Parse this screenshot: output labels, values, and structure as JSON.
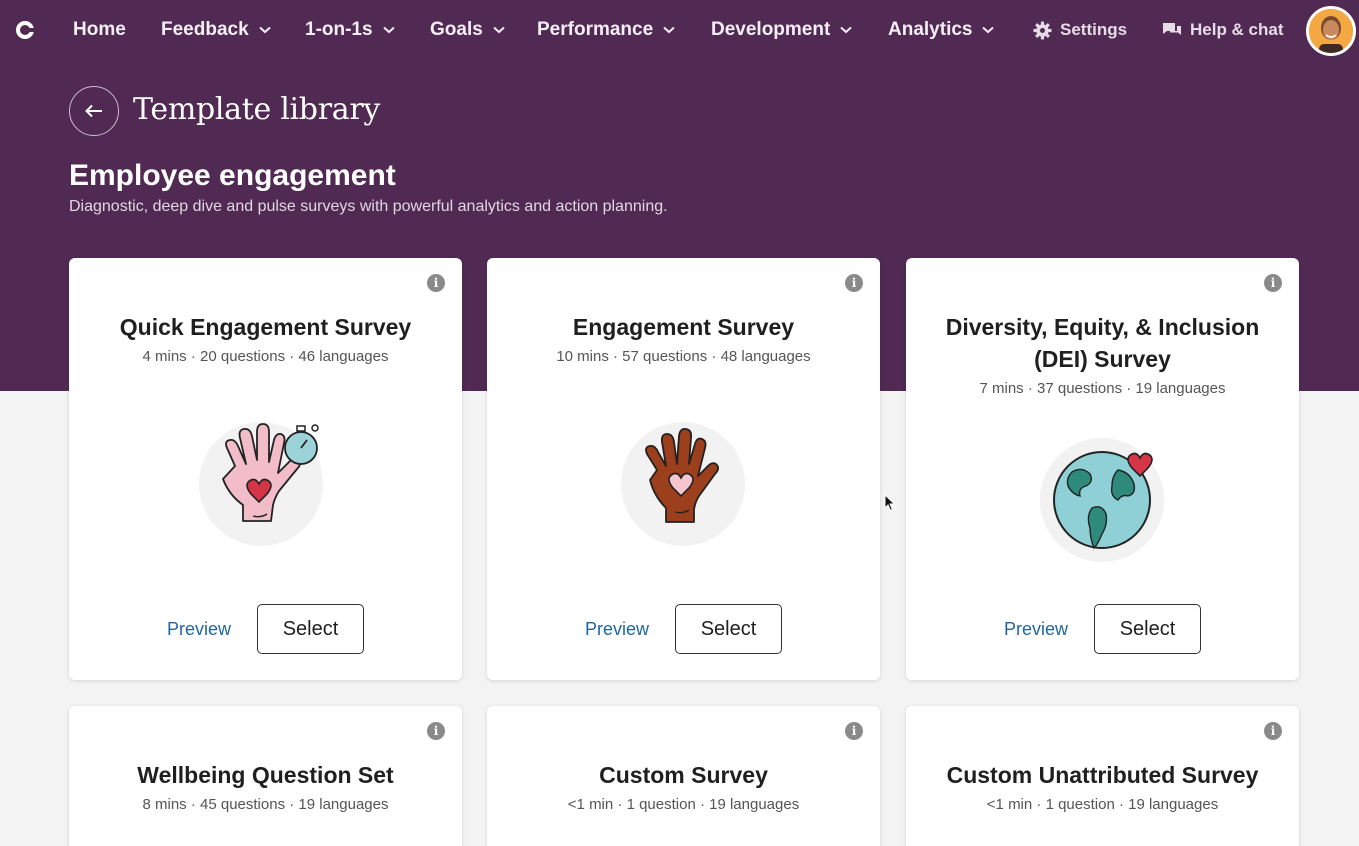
{
  "nav": {
    "items": [
      {
        "label": "Home",
        "has_dropdown": false
      },
      {
        "label": "Feedback",
        "has_dropdown": true
      },
      {
        "label": "1-on-1s",
        "has_dropdown": true
      },
      {
        "label": "Goals",
        "has_dropdown": true
      },
      {
        "label": "Performance",
        "has_dropdown": true
      },
      {
        "label": "Development",
        "has_dropdown": true
      },
      {
        "label": "Analytics",
        "has_dropdown": true
      }
    ],
    "settings_label": "Settings",
    "help_label": "Help & chat"
  },
  "header": {
    "title": "Template library"
  },
  "section": {
    "title": "Employee engagement",
    "description": "Diagnostic, deep dive and pulse surveys with powerful analytics and action planning."
  },
  "cards": [
    {
      "title": "Quick Engagement Survey",
      "meta": "4 mins · 20 questions · 46 languages",
      "preview_label": "Preview",
      "select_label": "Select",
      "illustration": "hand-heart-stopwatch-icon"
    },
    {
      "title": "Engagement Survey",
      "meta": "10 mins · 57 questions · 48 languages",
      "preview_label": "Preview",
      "select_label": "Select",
      "illustration": "hand-heart-icon"
    },
    {
      "title": "Diversity, Equity, & Inclusion (DEI) Survey",
      "meta": "7 mins · 37 questions · 19 languages",
      "preview_label": "Preview",
      "select_label": "Select",
      "illustration": "globe-heart-icon"
    },
    {
      "title": "Wellbeing Question Set",
      "meta": "8 mins · 45 questions · 19 languages"
    },
    {
      "title": "Custom Survey",
      "meta": "<1 min · 1 question · 19 languages"
    },
    {
      "title": "Custom Unattributed Survey",
      "meta": "<1 min · 1 question · 19 languages"
    }
  ],
  "colors": {
    "brand_purple": "#502a53",
    "link_blue": "#21669e",
    "page_bg": "#f3f3f3"
  }
}
